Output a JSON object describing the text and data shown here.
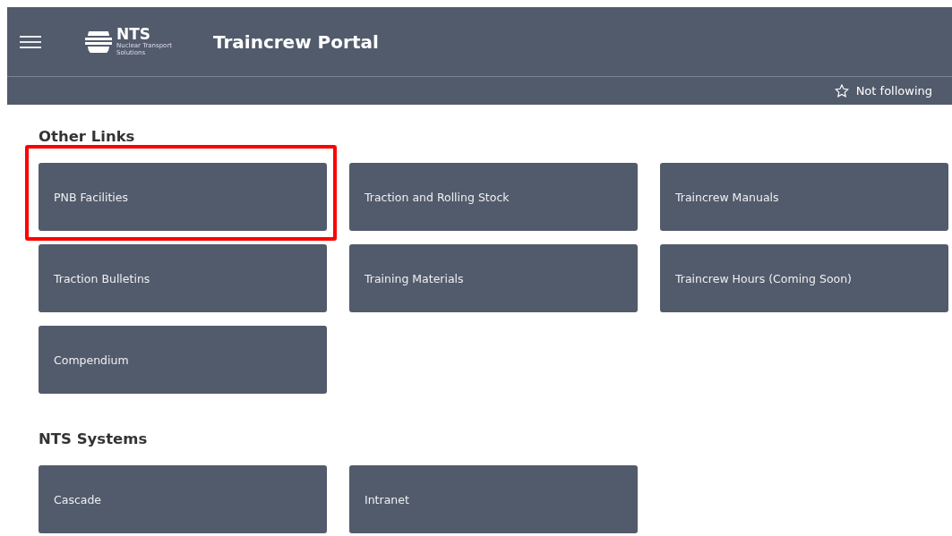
{
  "header": {
    "logo": {
      "name": "NTS",
      "subtitle": "Nuclear Transport Solutions"
    },
    "title": "Traincrew Portal",
    "follow": {
      "label": "Not following",
      "following": false
    }
  },
  "sections": [
    {
      "title": "Other Links",
      "tiles": [
        {
          "label": "PNB Facilities",
          "highlighted": true
        },
        {
          "label": "Traction and Rolling Stock",
          "highlighted": false
        },
        {
          "label": "Traincrew Manuals",
          "highlighted": false
        },
        {
          "label": "Traction Bulletins",
          "highlighted": false
        },
        {
          "label": "Training Materials",
          "highlighted": false
        },
        {
          "label": "Traincrew Hours (Coming Soon)",
          "highlighted": false
        },
        {
          "label": "Compendium",
          "highlighted": false
        }
      ]
    },
    {
      "title": "NTS Systems",
      "tiles": [
        {
          "label": "Cascade",
          "highlighted": false
        },
        {
          "label": "Intranet",
          "highlighted": false
        }
      ]
    }
  ]
}
